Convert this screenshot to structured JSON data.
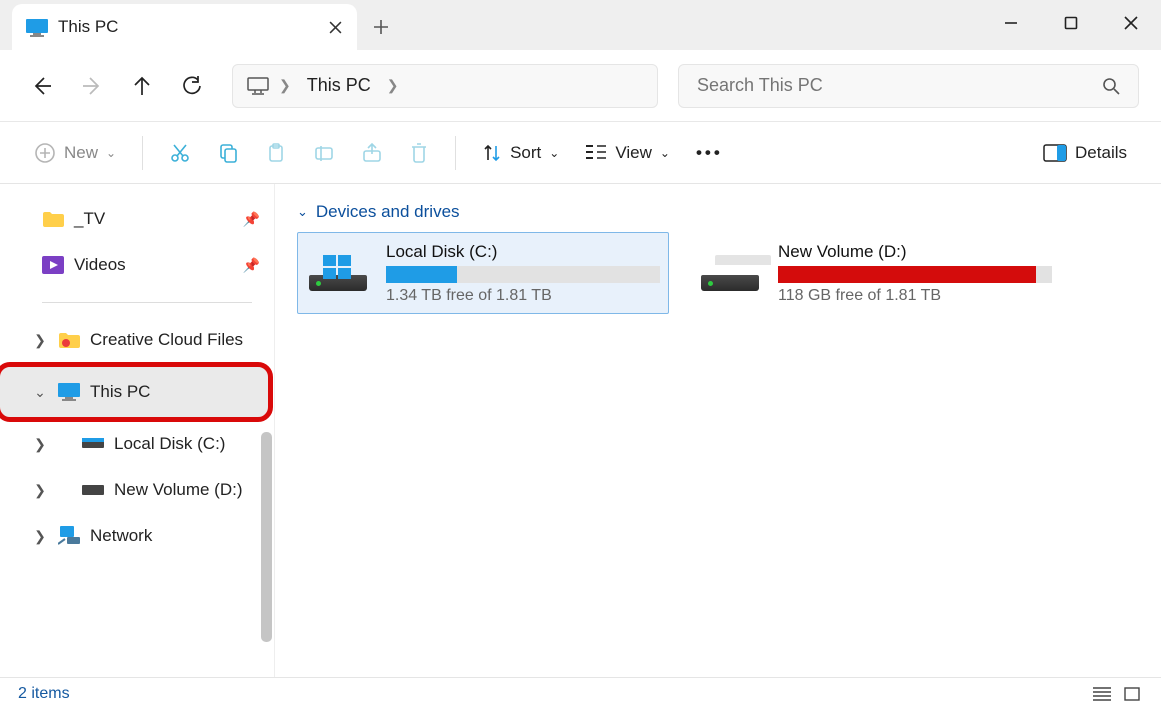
{
  "tab": {
    "title": "This PC"
  },
  "breadcrumb": {
    "crumb": "This PC"
  },
  "search": {
    "placeholder": "Search This PC"
  },
  "toolbar": {
    "new": "New",
    "sort": "Sort",
    "view": "View",
    "details": "Details"
  },
  "sidebar": {
    "tv": "_TV",
    "videos": "Videos",
    "creative": "Creative Cloud Files",
    "thispc": "This PC",
    "localc": "Local Disk (C:)",
    "newvol": "New Volume (D:)",
    "network": "Network"
  },
  "content": {
    "groupTitle": "Devices and drives",
    "drives": [
      {
        "name": "Local Disk (C:)",
        "free": "1.34 TB free of 1.81 TB",
        "fillPct": 26,
        "color": "#1f9ce6",
        "selected": true,
        "logo": "win"
      },
      {
        "name": "New Volume (D:)",
        "free": "118 GB free of 1.81 TB",
        "fillPct": 94,
        "color": "#d40c0c",
        "selected": false,
        "logo": "none"
      }
    ]
  },
  "status": {
    "text": "2 items"
  }
}
